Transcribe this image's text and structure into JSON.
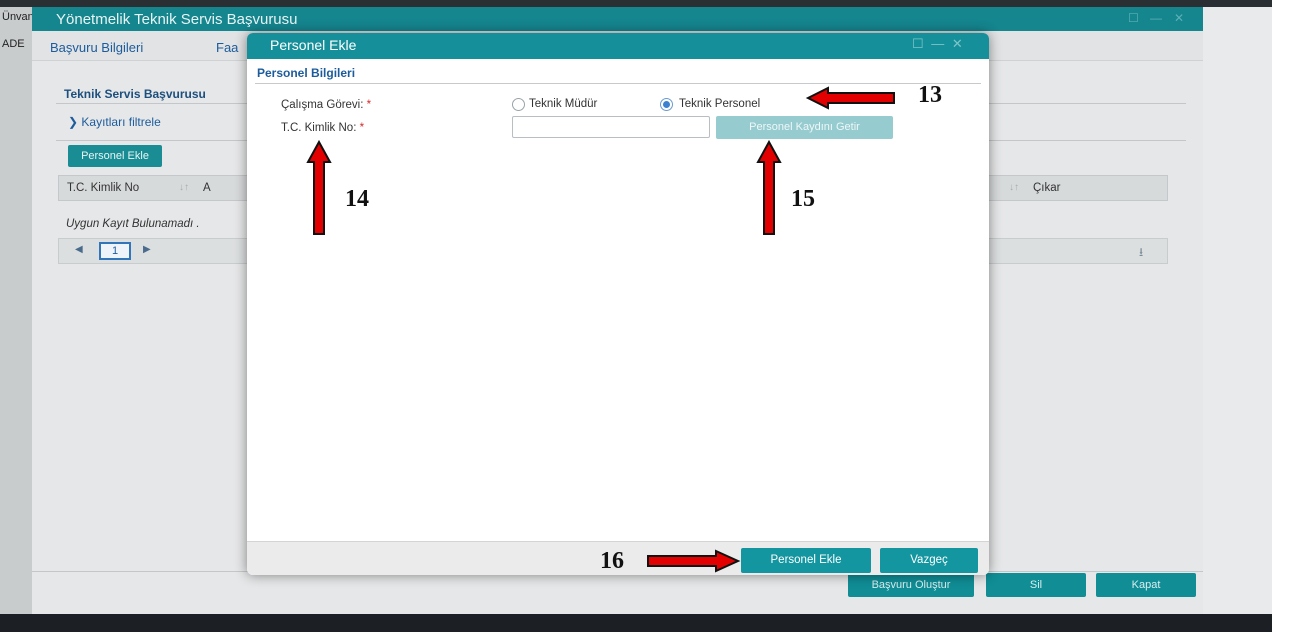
{
  "background": {
    "left_fragment_top": "Ünvan",
    "left_fragment_tabs": "ADE",
    "window": {
      "title": "Yönetmelik Teknik Servis Başvurusu",
      "tabs": [
        "Başvuru Bilgileri",
        "Faa"
      ],
      "panel_title": "Teknik Servis Başvurusu",
      "filter_label": "Kayıtları filtrele",
      "add_button": "Personel Ekle",
      "columns": [
        "T.C. Kimlik No",
        "A",
        "Çıkar"
      ],
      "empty_text": "Uygun Kayıt Bulunamadı .",
      "pager": {
        "page": "1"
      },
      "footer_buttons": [
        "Başvuru Oluştur",
        "Sil",
        "Kapat"
      ]
    }
  },
  "modal": {
    "title": "Personel Ekle",
    "section_title": "Personel Bilgileri",
    "gorev_label": "Çalışma Görevi:",
    "tc_label": "T.C. Kimlik No:",
    "required_mark": "*",
    "radio_options": [
      {
        "label": "Teknik Müdür",
        "selected": false
      },
      {
        "label": "Teknik Personel",
        "selected": true
      }
    ],
    "tc_value": "",
    "getir_button": "Personel Kaydını Getir",
    "ok_button": "Personel Ekle",
    "cancel_button": "Vazgeç"
  },
  "annotations": [
    {
      "number": "13",
      "direction": "left"
    },
    {
      "number": "14",
      "direction": "up"
    },
    {
      "number": "15",
      "direction": "up"
    },
    {
      "number": "16",
      "direction": "right"
    }
  ],
  "colors": {
    "title_teal": "#15909a",
    "button_teal": "#1396a0",
    "disabled_teal": "#96cbd0",
    "arrow_red": "#e30000",
    "required_red": "#d42a2a"
  }
}
